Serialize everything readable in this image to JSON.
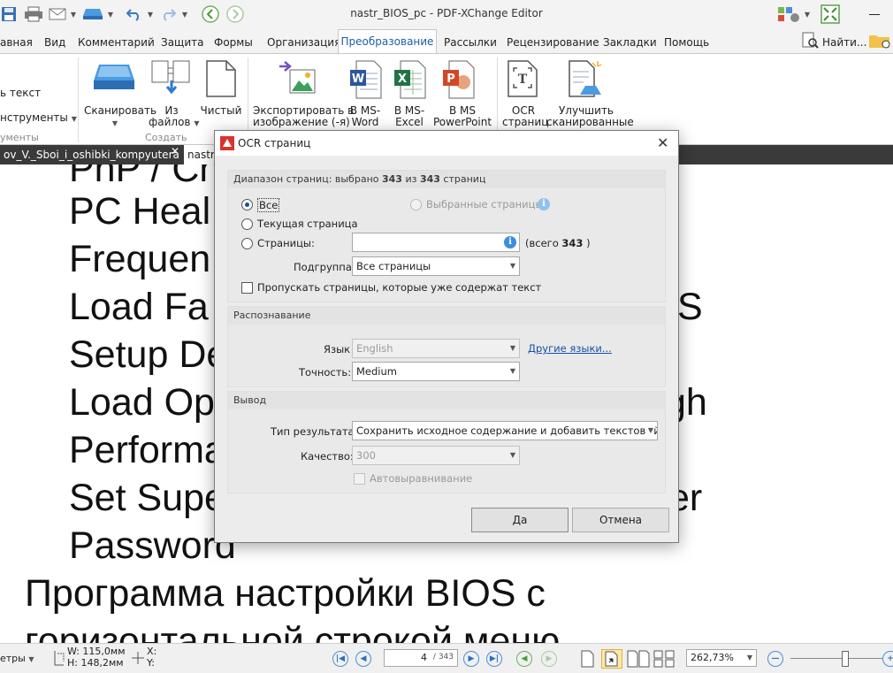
{
  "window": {
    "title": "nastr_BIOS_pc - PDF-XChange Editor",
    "find_label": "Найти..."
  },
  "menu": {
    "tabs": [
      "авная",
      "Вид",
      "Комментарий",
      "Защита",
      "Формы",
      "Организация",
      "Преобразование",
      "Рассылки",
      "Рецензирование",
      "Закладки",
      "Помощь"
    ],
    "active": "Преобразование"
  },
  "ribbon": {
    "left_partial": {
      "item1": "ь текст",
      "item2": "нструменты",
      "group": "ументы"
    },
    "create_group": {
      "label": "Создать",
      "scan": "Сканировать",
      "from_files_line1": "Из",
      "from_files_line2": "файлов",
      "blank": "Чистый"
    },
    "export_image_line1": "Экспортировать в",
    "export_image_line2": "изображение (-я)",
    "to_word_line1": "В MS-",
    "to_word_line2": "Word",
    "to_excel_line1": "В MS-",
    "to_excel_line2": "Excel",
    "to_ppt_line1": "В MS",
    "to_ppt_line2": "PowerPoint",
    "ocr_line1": "OCR",
    "ocr_line2": "страниц",
    "enhance_line1": "Улучшить",
    "enhance_line2": "сканированные"
  },
  "doc_tabs": [
    {
      "label": "ov_V._Sboi_i_oshibki_kompyutera *"
    },
    {
      "label": "nastr_"
    }
  ],
  "document": {
    "lines": [
      "PnP / Ch",
      "PC Heal",
      "Frequen",
      "Load Fa",
      "Setup De",
      "Load Op",
      "Performa",
      "Set Supe",
      "Password",
      "Программа настройки BIOS с",
      "горизонтальной строкой меню"
    ],
    "right_fragments": [
      "S",
      "gh",
      "er"
    ]
  },
  "dialog": {
    "title": "OCR страниц",
    "range_section": {
      "header_prefix": "Диапазон страниц: выбрано ",
      "selected": "343",
      "header_mid": " из ",
      "total": "343",
      "header_suffix": " страниц",
      "opt_all": "Все",
      "opt_selected": "Выбранные страницы",
      "opt_current": "Текущая страница",
      "opt_pages": "Страницы:",
      "pages_value": "",
      "total_note_prefix": "(всего ",
      "total_note_value": "343",
      "total_note_suffix": " )",
      "subset_label": "Подгруппа:",
      "subset_value": "Все страницы",
      "skip_text": "Пропускать страницы, которые уже содержат текст"
    },
    "recognition": {
      "header": "Распознавание",
      "lang_label": "Язык",
      "lang_value": "English",
      "other_langs": "Другие языки...",
      "accuracy_label": "Точность:",
      "accuracy_value": "Medium"
    },
    "output": {
      "header": "Вывод",
      "type_label": "Тип результата:",
      "type_value": "Сохранить исходное содержание и добавить текстовый сло",
      "quality_label": "Качество:",
      "quality_value": "300",
      "autoalign": "Автовыравнивание"
    },
    "ok": "Да",
    "cancel": "Отмена"
  },
  "statusbar": {
    "left_partial": "етры",
    "w_label": "W: 115,0мм",
    "h_label": "H: 148,2мм",
    "x_label": "X:",
    "y_label": "Y:",
    "page_current": "4",
    "page_total": "/ 343",
    "zoom": "262,73%"
  },
  "colors": {
    "accent": "#1d5fa8",
    "doc_tab_bar": "#3a3a3a",
    "info_blue": "#3b8ee0"
  }
}
